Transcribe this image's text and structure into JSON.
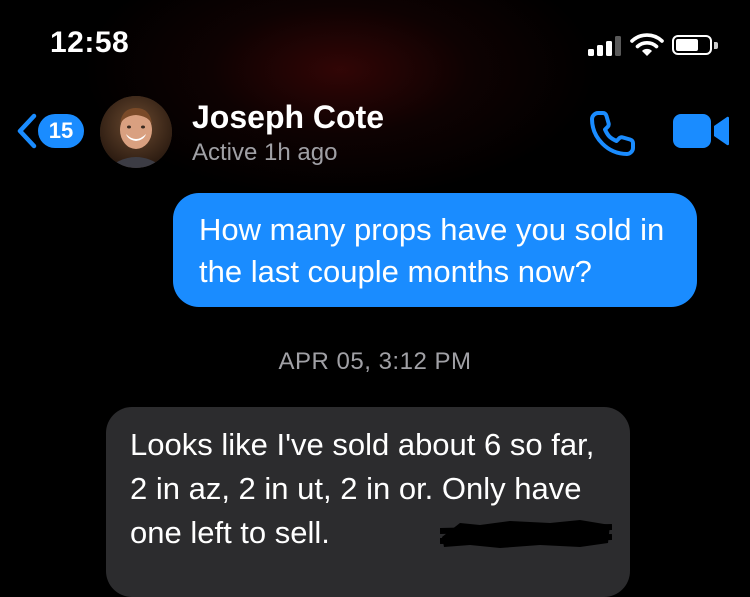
{
  "status_bar": {
    "time": "12:58",
    "icons": [
      "cellular-signal-icon",
      "wifi-icon",
      "battery-icon"
    ]
  },
  "header": {
    "back_icon": "chevron-left-icon",
    "unread_badge": "15",
    "contact_name": "Joseph Cote",
    "contact_status": "Active 1h ago",
    "actions": [
      "phone-icon",
      "video-camera-icon"
    ],
    "accent_color": "#1a8cff"
  },
  "messages": {
    "outgoing_1": "How many props have you sold in the last couple months now?",
    "timestamp": "APR 05, 3:12 PM",
    "incoming_1": "Looks like I've sold about 6 so far, 2 in az, 2 in ut, 2 in or. Only have one left to sell."
  },
  "colors": {
    "outgoing_bubble": "#1a8cff",
    "incoming_bubble": "#2c2c2e",
    "secondary_text": "#a0a0a5"
  }
}
